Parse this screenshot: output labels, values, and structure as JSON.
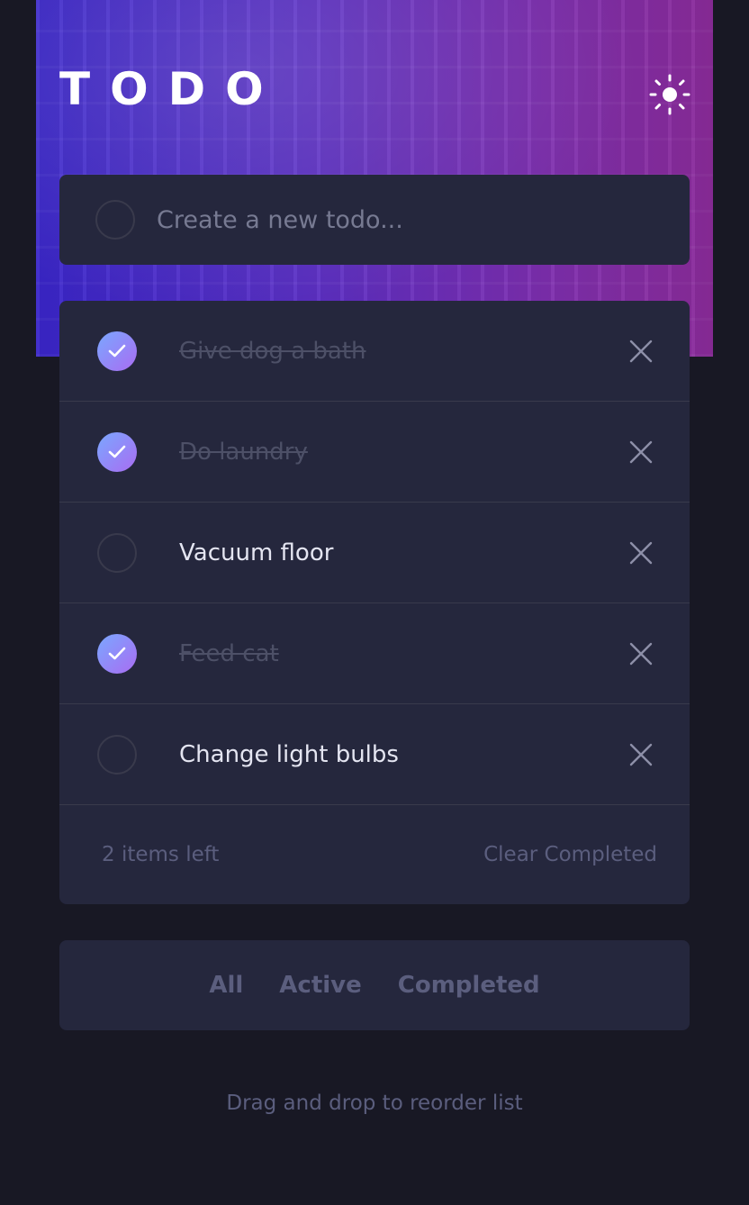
{
  "app": {
    "title": "TODO",
    "theme_toggle_icon": "sun-icon",
    "accent_gradient": [
      "#7aa8ff",
      "#a96cf2"
    ]
  },
  "new_todo": {
    "placeholder": "Create a new todo...",
    "value": ""
  },
  "todos": [
    {
      "text": "Give dog a bath",
      "completed": true
    },
    {
      "text": "Do laundry",
      "completed": true
    },
    {
      "text": "Vacuum floor",
      "completed": false
    },
    {
      "text": "Feed cat",
      "completed": true
    },
    {
      "text": "Change light bulbs",
      "completed": false
    }
  ],
  "footer": {
    "items_left": "2 items left",
    "clear_label": "Clear Completed"
  },
  "filters": {
    "all": "All",
    "active": "Active",
    "completed": "Completed"
  },
  "hint": "Drag and drop to reorder list"
}
